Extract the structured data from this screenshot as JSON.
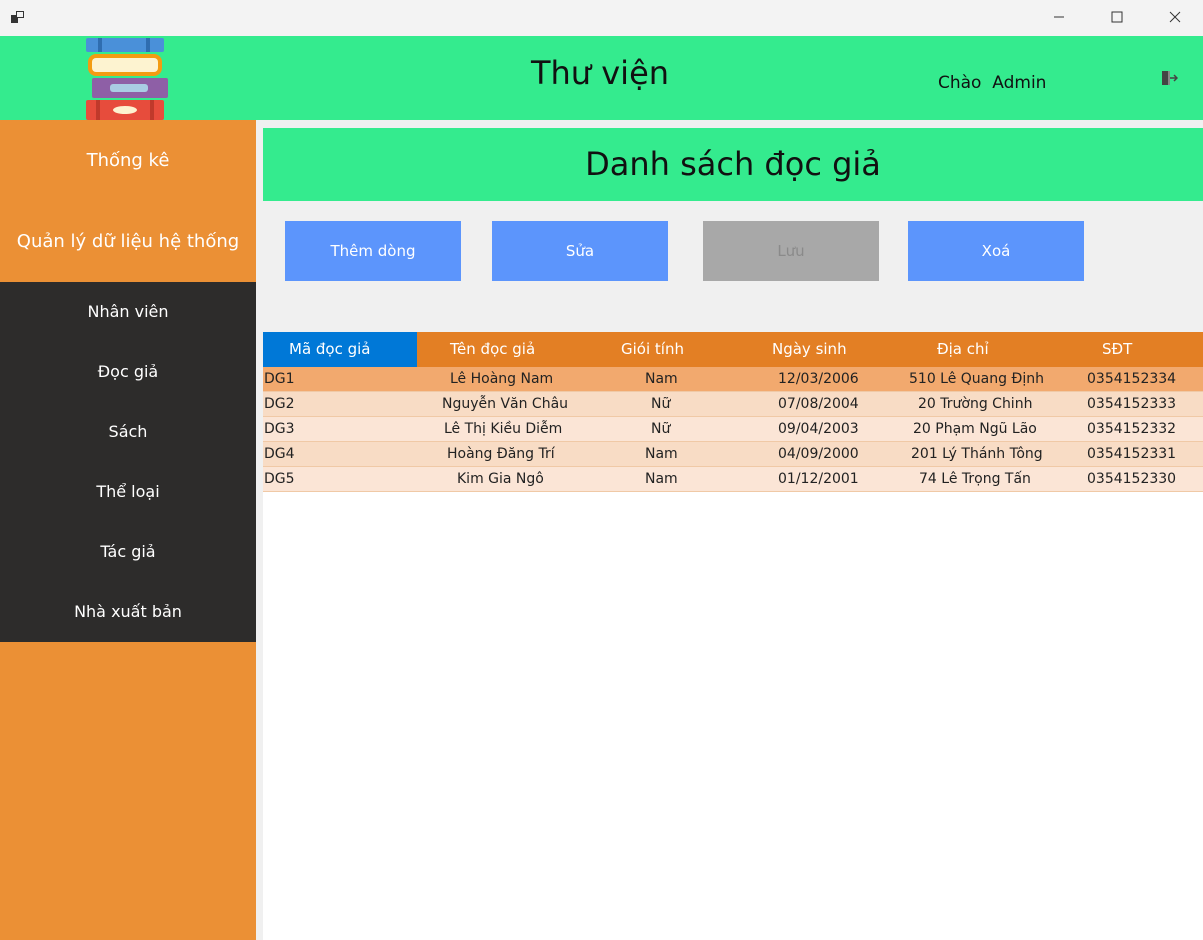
{
  "window": {
    "controls": {
      "minimize_icon": "minimize-icon",
      "maximize_icon": "maximize-icon",
      "close_icon": "close-icon"
    }
  },
  "header": {
    "title": "Thư viện",
    "greeting_prefix": "Chào",
    "user": "Admin",
    "colors": {
      "accent": "#34eb8e"
    }
  },
  "sidebar": {
    "top_items": [
      "Thống kê",
      "Quản lý dữ liệu hệ thống"
    ],
    "sub_items": [
      "Nhân viên",
      "Đọc giả",
      "Sách",
      "Thể loại",
      "Tác giả",
      "Nhà xuất bản"
    ],
    "colors": {
      "sidebar_bg": "#eb9035",
      "submenu_bg": "#2d2c2b"
    }
  },
  "content": {
    "title": "Danh sách đọc giả",
    "buttons": [
      {
        "label": "Thêm dòng",
        "enabled": true
      },
      {
        "label": "Sửa",
        "enabled": true
      },
      {
        "label": "Lưu",
        "enabled": false
      },
      {
        "label": "Xoá",
        "enabled": true
      }
    ]
  },
  "table": {
    "columns": [
      "Mã đọc giả",
      "Tên đọc giả",
      "Giói tính",
      "Ngày sinh",
      "Địa chỉ",
      "SĐT"
    ],
    "selected_column": 0,
    "rows": [
      [
        "DG1",
        "Lê Hoàng Nam",
        "Nam",
        "12/03/2006",
        "510 Lê Quang Định",
        "0354152334"
      ],
      [
        "DG2",
        "Nguyễn Văn Châu",
        "Nữ",
        "07/08/2004",
        "20 Trường Chinh",
        "0354152333"
      ],
      [
        "DG3",
        "Lê Thị Kiều Diễm",
        "Nữ",
        "09/04/2003",
        "20 Phạm Ngũ Lão",
        "0354152332"
      ],
      [
        "DG4",
        "Hoàng Đăng Trí",
        "Nam",
        "04/09/2000",
        "201 Lý Thánh Tông",
        "0354152331"
      ],
      [
        "DG5",
        "Kim Gia Ngô",
        "Nam",
        "01/12/2001",
        "74 Lê Trọng Tấn",
        "0354152330"
      ]
    ],
    "colors": {
      "header_bg": "#e37f24",
      "selected_header_bg": "#0078d7",
      "row_selected_bg": "#f2a96e",
      "row_bg": "#f8dcc5"
    }
  }
}
